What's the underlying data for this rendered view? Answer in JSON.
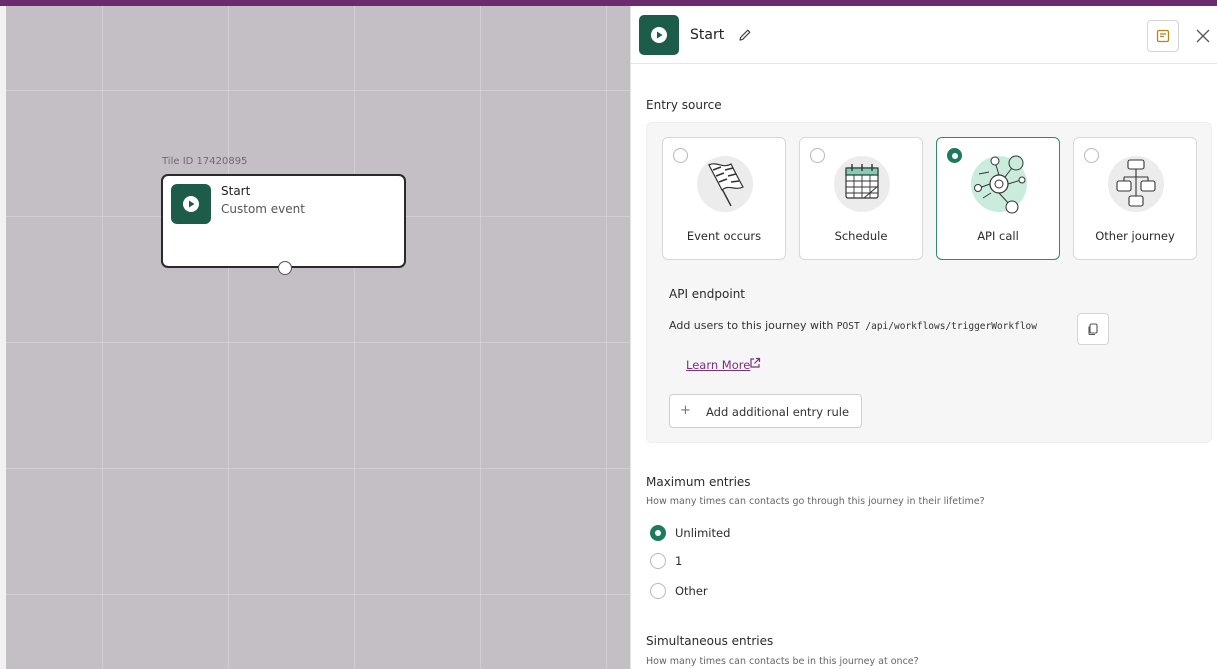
{
  "canvas": {
    "tile_id": "Tile ID 17420895",
    "node": {
      "title": "Start",
      "subtitle": "Custom event",
      "icon": "play-icon"
    }
  },
  "panel": {
    "header": {
      "title": "Start",
      "edit_icon": "pencil-icon",
      "notes_icon": "notes-icon",
      "close_icon": "close-icon"
    },
    "entry_source": {
      "title": "Entry source",
      "options": [
        {
          "label": "Event occurs",
          "icon": "flag-icon",
          "selected": false
        },
        {
          "label": "Schedule",
          "icon": "calendar-icon",
          "selected": false
        },
        {
          "label": "API call",
          "icon": "api-network-icon",
          "selected": true
        },
        {
          "label": "Other journey",
          "icon": "flowchart-icon",
          "selected": false
        }
      ]
    },
    "api": {
      "title": "API endpoint",
      "desc_prefix": "Add users to this journey with",
      "endpoint": "POST /api/workflows/triggerWorkflow",
      "copy_icon": "copy-icon",
      "learn_more": "Learn More",
      "external_icon": "external-link-icon",
      "add_rule": "Add additional entry rule"
    },
    "max_entries": {
      "title": "Maximum entries",
      "desc": "How many times can contacts go through this journey in their lifetime?",
      "options": [
        {
          "label": "Unlimited",
          "checked": true
        },
        {
          "label": "1",
          "checked": false
        },
        {
          "label": "Other",
          "checked": false
        }
      ]
    },
    "simultaneous": {
      "title": "Simultaneous entries",
      "desc": "How many times can contacts be in this journey at once?"
    }
  },
  "colors": {
    "brand_green": "#1c5c48",
    "accent_purple": "#6b2b6e",
    "selected_border": "#2c8a6f"
  }
}
